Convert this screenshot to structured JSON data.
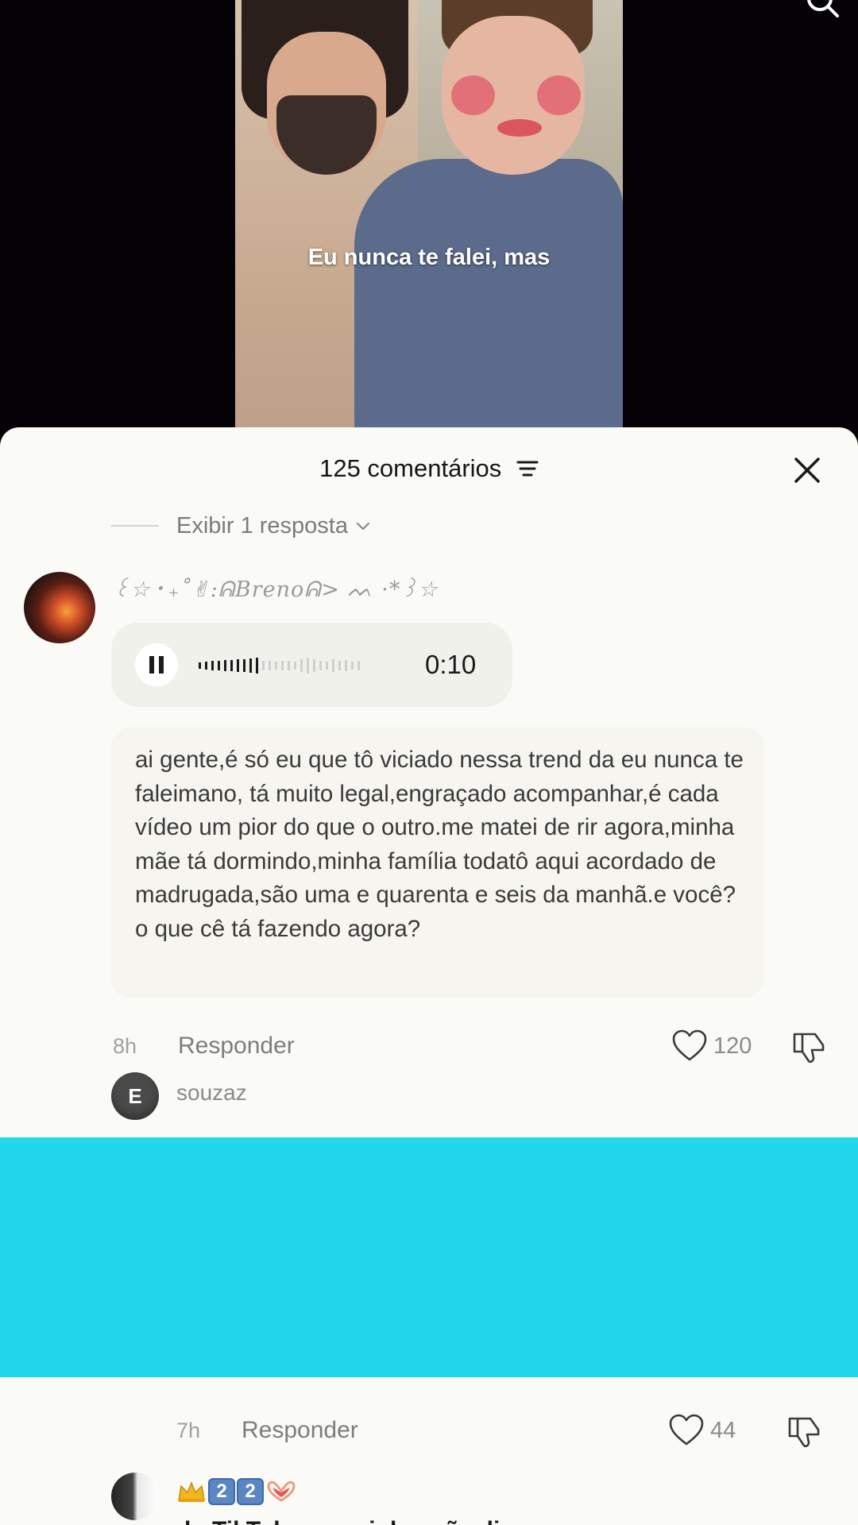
{
  "video": {
    "caption": "Eu nunca te falei, mas"
  },
  "header": {
    "comment_count": "125 comentários"
  },
  "thread": {
    "view_replies_label": "Exibir 1 resposta"
  },
  "comment_main": {
    "username": "꒰☆・₊˚✌︎:ᕱBrenoᕱ> ᨓ ·*꒱☆",
    "audio_duration": "0:10",
    "text": "ai gente,é só eu que tô viciado nessa trend da eu nunca te faleimano, tá muito legal,engraçado acompanhar,é cada vídeo um pior do que o outro.me matei de rir agora,minha mãe tá dormindo,minha família todatô aqui acordado de madrugada,são uma e quarenta e seis da manhã.e você? o que cê tá fazendo agora?",
    "time": "8h",
    "reply_label": "Responder",
    "likes": "120"
  },
  "reply_1": {
    "avatar_letter": "E",
    "username": "souzaz",
    "time": "7h",
    "reply_label": "Responder",
    "likes": "44"
  },
  "reply_2": {
    "badge_1": "2",
    "badge_2": "2",
    "text_fragment": "do TikTok mas minha mãe disse"
  },
  "colors": {
    "overlay": "#22d6ec",
    "sheet_bg": "#fafaf6"
  }
}
